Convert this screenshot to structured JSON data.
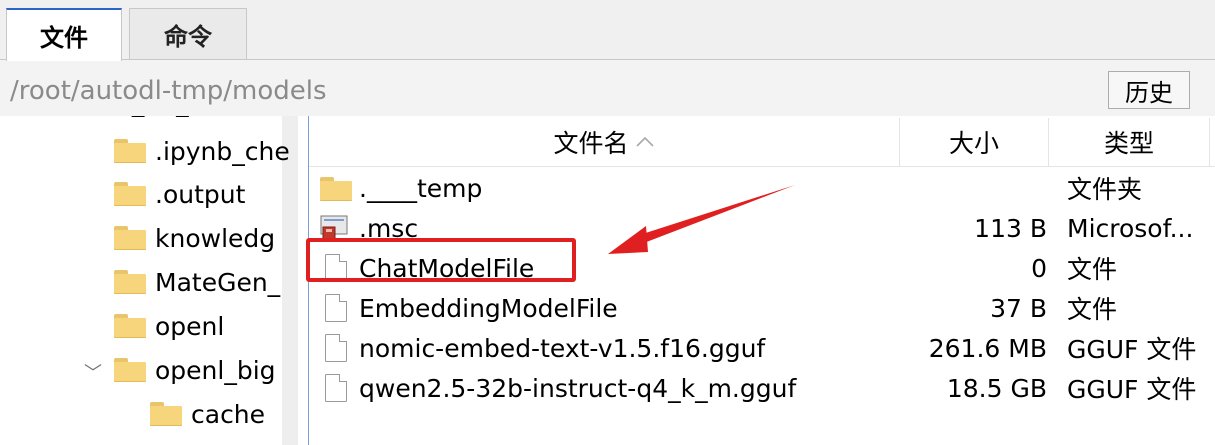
{
  "tabs": {
    "file": "文件",
    "command": "命令"
  },
  "path": {
    "value": "/root/autodl-tmp/models",
    "history_label": "历史"
  },
  "tree": {
    "items": [
      {
        "label": ".ipynb_che",
        "icon": "folder-icon"
      },
      {
        "label": ".output",
        "icon": "folder-icon"
      },
      {
        "label": "knowledg",
        "icon": "folder-icon"
      },
      {
        "label": "MateGen_",
        "icon": "folder-icon"
      },
      {
        "label": "openl",
        "icon": "folder-icon"
      },
      {
        "label": "openl_big",
        "icon": "folder-icon",
        "expanded": true
      },
      {
        "label": "cache",
        "icon": "folder-icon"
      }
    ],
    "expand_glyph": "﹀"
  },
  "columns": {
    "name": "文件名",
    "size": "大小",
    "type": "类型",
    "sort_indicator": "^"
  },
  "files": [
    {
      "name": ".____temp",
      "size": "",
      "type": "文件夹",
      "icon": "folder-icon"
    },
    {
      "name": ".msc",
      "size": "113 B",
      "type": "Microsof...",
      "icon": "msc-icon"
    },
    {
      "name": "ChatModelFile",
      "size": "0",
      "type": "文件",
      "icon": "file-icon"
    },
    {
      "name": "EmbeddingModelFile",
      "size": "37 B",
      "type": "文件",
      "icon": "file-icon"
    },
    {
      "name": "nomic-embed-text-v1.5.f16.gguf",
      "size": "261.6 MB",
      "type": "GGUF 文件",
      "icon": "file-icon"
    },
    {
      "name": "qwen2.5-32b-instruct-q4_k_m.gguf",
      "size": "18.5 GB",
      "type": "GGUF 文件",
      "icon": "file-icon"
    }
  ],
  "annotation": {
    "color": "#e02020",
    "highlighted": "ChatModelFile"
  }
}
